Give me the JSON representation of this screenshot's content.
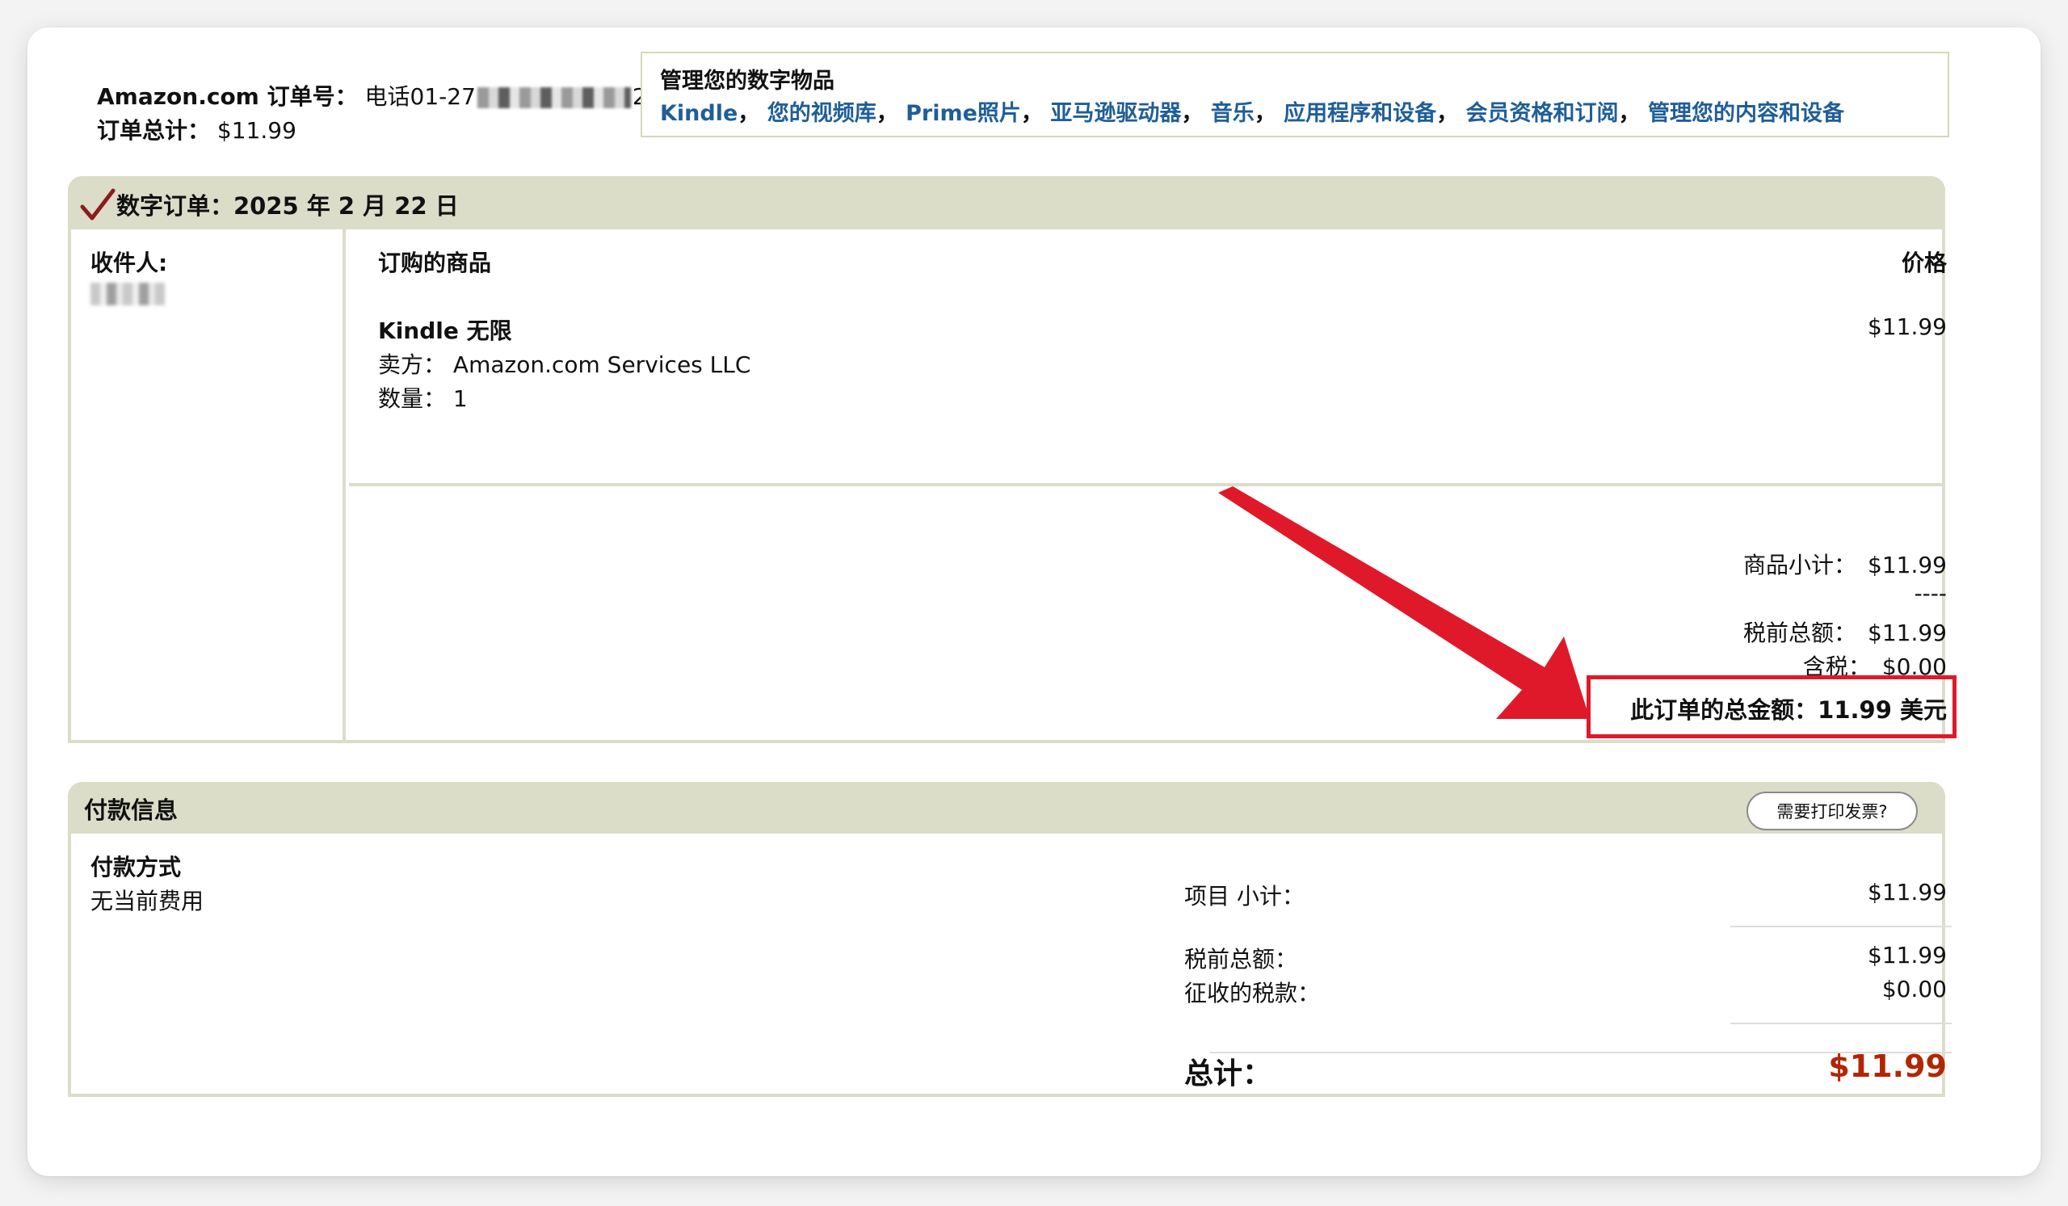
{
  "header": {
    "order_number_label": "Amazon.com 订单号：",
    "order_number_prefix": "电话01-27",
    "order_number_suffix": "2",
    "order_total_label": "订单总计：",
    "order_total_value": "$11.99"
  },
  "manage": {
    "title": "管理您的数字物品",
    "links": [
      "Kindle",
      "您的视频库",
      "Prime照片",
      "亚马逊驱动器",
      "音乐",
      "应用程序和设备",
      "会员资格和订阅",
      "管理您的内容和设备"
    ],
    "separator": "，"
  },
  "order": {
    "title": "数字订单：2025 年 2 月 22 日",
    "recipient_label": "收件人:",
    "items_header": "订购的商品",
    "price_header": "价格",
    "item_name": "Kindle 无限",
    "seller_label": "卖方：",
    "seller_value": "Amazon.com Services LLC",
    "qty_label": "数量：",
    "qty_value": "1",
    "item_price": "$11.99",
    "subtotal_label": "商品小计：",
    "subtotal_value": "$11.99",
    "dashes": "----",
    "pretax_label": "税前总额：",
    "pretax_value": "$11.99",
    "tax_label": "含税：",
    "tax_value": "$0.00",
    "grand_total": "此订单的总金额：11.99 美元"
  },
  "payment": {
    "title": "付款信息",
    "invoice_button": "需要打印发票?",
    "method_label": "付款方式",
    "method_value": "无当前费用",
    "item_subtotal_label": "项目 小计：",
    "item_subtotal_value": "$11.99",
    "pretax_label": "税前总额：",
    "pretax_value": "$11.99",
    "tax_label": "征收的税款：",
    "tax_value": "$0.00",
    "total_label": "总计：",
    "total_value": "$11.99"
  },
  "colors": {
    "link": "#1f5e98",
    "section_header": "#dcddc9",
    "highlight_border": "#e0192a",
    "price_red": "#b12704"
  },
  "icons": [
    "checkmark-icon",
    "red-arrow-annotation"
  ]
}
